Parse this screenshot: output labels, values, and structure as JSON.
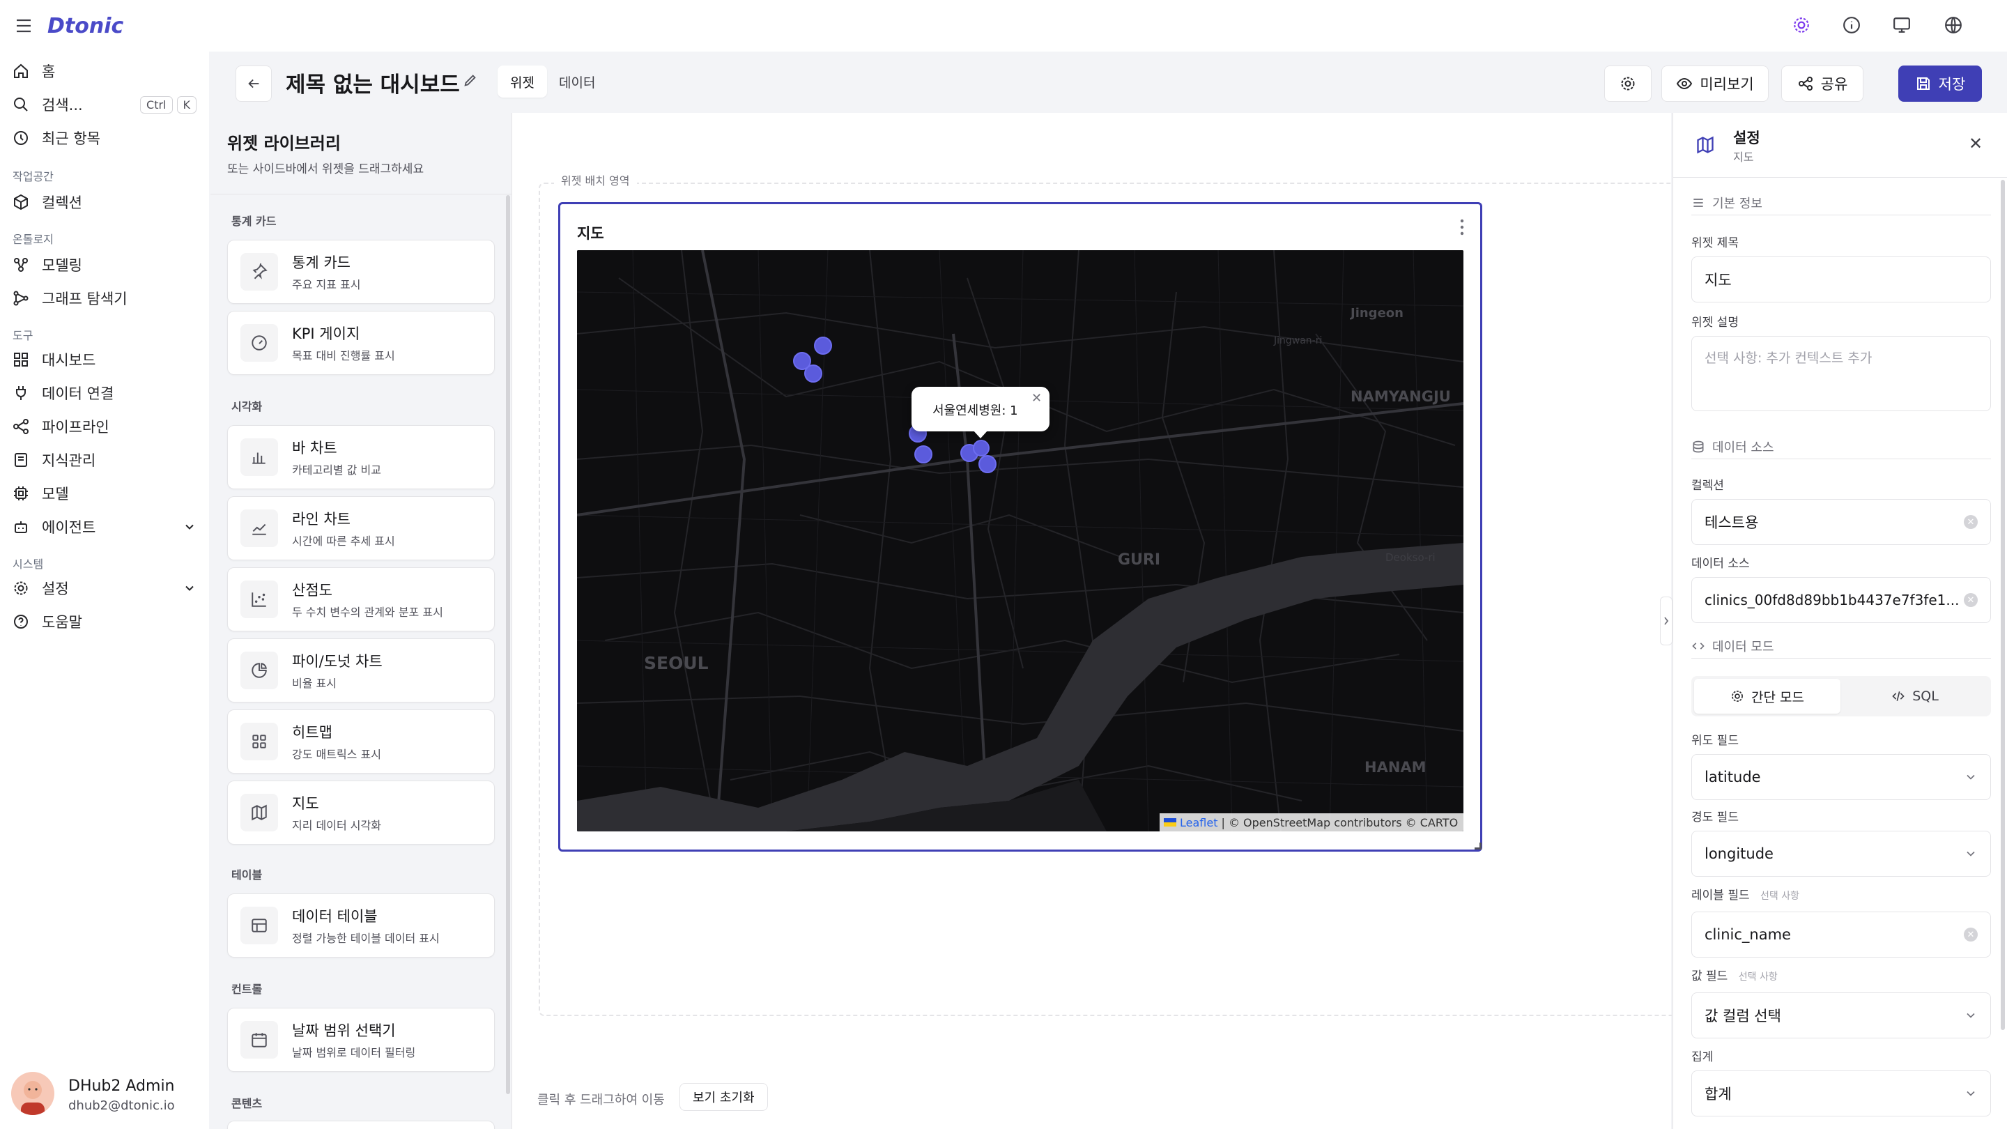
{
  "app": {
    "logo": "Dtonic"
  },
  "nav": {
    "home": "홈",
    "search": "검색...",
    "search_kbd1": "Ctrl",
    "search_kbd2": "K",
    "recent": "최근 항목",
    "workspace_section": "작업공간",
    "collections": "컬렉션",
    "ontology_section": "온톨로지",
    "modeling": "모델링",
    "graph_explorer": "그래프 탐색기",
    "tools_section": "도구",
    "dashboard": "대시보드",
    "data_connection": "데이터 연결",
    "pipeline": "파이프라인",
    "knowledge": "지식관리",
    "model": "모델",
    "agent": "에이전트",
    "system_section": "시스템",
    "settings": "설정",
    "help": "도움말"
  },
  "user": {
    "name": "DHub2 Admin",
    "email": "dhub2@dtonic.io"
  },
  "header": {
    "title": "제목 없는 대시보드",
    "tab_widget": "위젯",
    "tab_data": "데이터",
    "preview": "미리보기",
    "share": "공유",
    "save": "저장"
  },
  "library": {
    "title": "위젯 라이브러리",
    "subtitle": "또는 사이드바에서 위젯을 드래그하세요",
    "sec_stats": "통계 카드",
    "sec_viz": "시각화",
    "sec_table": "테이블",
    "sec_control": "컨트롤",
    "sec_content": "콘텐츠",
    "items": [
      {
        "title": "통계 카드",
        "desc": "주요 지표 표시",
        "icon": "pin-icon"
      },
      {
        "title": "KPI 게이지",
        "desc": "목표 대비 진행률 표시",
        "icon": "gauge-icon"
      },
      {
        "title": "바 차트",
        "desc": "카테고리별 값 비교",
        "icon": "bar-chart-icon"
      },
      {
        "title": "라인 차트",
        "desc": "시간에 따른 추세 표시",
        "icon": "line-chart-icon"
      },
      {
        "title": "산점도",
        "desc": "두 수치 변수의 관계와 분포 표시",
        "icon": "scatter-icon"
      },
      {
        "title": "파이/도넛 차트",
        "desc": "비율 표시",
        "icon": "pie-icon"
      },
      {
        "title": "히트맵",
        "desc": "강도 매트릭스 표시",
        "icon": "grid-icon"
      },
      {
        "title": "지도",
        "desc": "지리 데이터 시각화",
        "icon": "map-icon"
      },
      {
        "title": "데이터 테이블",
        "desc": "정렬 가능한 테이블 데이터 표시",
        "icon": "table-icon"
      },
      {
        "title": "날짜 범위 선택기",
        "desc": "날짜 범위로 데이터 필터링",
        "icon": "calendar-icon"
      }
    ]
  },
  "canvas": {
    "area_label": "위젯 배치 영역",
    "widget_title": "지도",
    "map_labels": {
      "jingeon": "Jingeon",
      "jingwan": "Jingwan-ri",
      "namyangju": "NAMYANGJU",
      "guri": "GURI",
      "deokso": "Deokso-ri",
      "seoul": "SEOUL",
      "hanam": "HANAM"
    },
    "popup": "서울연세병원: 1",
    "attribution_leaflet": "Leaflet",
    "attribution_rest": "| © OpenStreetMap contributors © CARTO",
    "hint": "클릭 후 드래그하여 이동",
    "reset_view": "보기 초기화"
  },
  "panel": {
    "title": "설정",
    "subtitle": "지도",
    "basic_info": "기본 정보",
    "widget_title_label": "위젯 제목",
    "widget_title_value": "지도",
    "widget_desc_label": "위젯 설명",
    "widget_desc_placeholder": "선택 사항: 추가 컨텍스트 추가",
    "data_source_section": "데이터 소스",
    "collection_label": "컬렉션",
    "collection_value": "테스트용",
    "data_source_label": "데이터 소스",
    "data_source_value": "clinics_00fd8d89bb1b4437e7f3fe1...",
    "data_mode_section": "데이터 모드",
    "simple_mode": "간단 모드",
    "sql_mode": "SQL",
    "lat_label": "위도 필드",
    "lat_value": "latitude",
    "lng_label": "경도 필드",
    "lng_value": "longitude",
    "label_field_label": "레이블 필드",
    "optional": "선택 사항",
    "label_field_value": "clinic_name",
    "value_field_label": "값 필드",
    "value_field_placeholder": "값 컬럼 선택",
    "agg_label": "집계",
    "agg_value": "합계"
  },
  "colors": {
    "accent": "#3f3fb5",
    "marker": "#5b5bdc",
    "map_bg": "#0d0d0f"
  }
}
